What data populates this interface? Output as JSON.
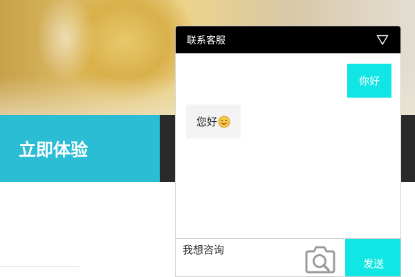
{
  "hero": {
    "image": "yellow-mug-photo"
  },
  "cta": {
    "label": "立即体验",
    "color": "#2bbdd3"
  },
  "chat": {
    "title": "联系客服",
    "collapse_icon": "triangle-down-icon",
    "messages": [
      {
        "from": "user",
        "text": "你好"
      },
      {
        "from": "agent",
        "text": "您好",
        "emoji": "smile-icon"
      }
    ],
    "input": {
      "value": "我想咨询"
    },
    "camera_icon": "camera-search-icon",
    "send_label": "发送",
    "accent": "#12e6e4",
    "header_color": "#000000"
  }
}
